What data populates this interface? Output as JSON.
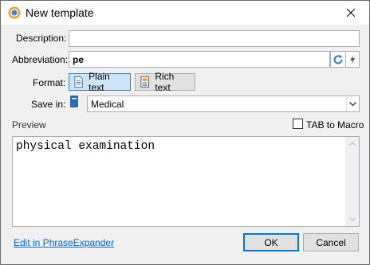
{
  "window": {
    "title": "New template"
  },
  "form": {
    "description_label": "Description:",
    "description_value": "",
    "abbreviation_label": "Abbreviation:",
    "abbreviation_value": "pe",
    "format_label": "Format:",
    "format_options": {
      "plain": "Plain text",
      "rich": "Rich text",
      "selected": "plain"
    },
    "save_in_label": "Save in:",
    "save_in_value": "Medical",
    "preview_label": "Preview",
    "tab_to_macro_label": "TAB to Macro",
    "tab_to_macro_checked": false,
    "preview_text": "physical examination"
  },
  "footer": {
    "edit_link": "Edit in PhraseExpander",
    "ok_label": "OK",
    "cancel_label": "Cancel"
  },
  "icons": {
    "app": "phraseexpander-app-icon",
    "close": "close-icon",
    "refresh": "refresh-icon",
    "lightning": "lightning-icon",
    "plain": "plain-text-icon",
    "rich": "rich-text-icon",
    "folder": "book-icon",
    "dropdown": "chevron-down-icon"
  },
  "colors": {
    "accent": "#0078d7",
    "link": "#0066cc",
    "selected_btn": "#cce4f7"
  }
}
